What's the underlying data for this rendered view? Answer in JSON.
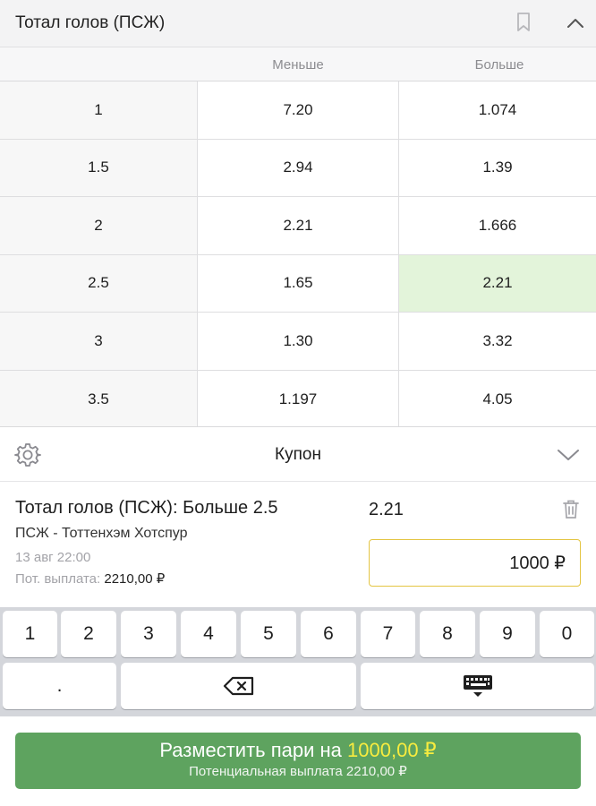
{
  "market": {
    "title": "Тотал голов (ПСЖ)",
    "icons": {
      "bookmark": "bookmark-icon",
      "collapse": "chevron-up-icon"
    }
  },
  "columns": {
    "total": "",
    "under": "Меньше",
    "over": "Больше"
  },
  "rows": [
    {
      "total": "1",
      "under": "7.20",
      "over": "1.074"
    },
    {
      "total": "1.5",
      "under": "2.94",
      "over": "1.39"
    },
    {
      "total": "2",
      "under": "2.21",
      "over": "1.666"
    },
    {
      "total": "2.5",
      "under": "1.65",
      "over": "2.21",
      "selected": "over"
    },
    {
      "total": "3",
      "under": "1.30",
      "over": "3.32"
    },
    {
      "total": "3.5",
      "under": "1.197",
      "over": "4.05"
    }
  ],
  "coupon": {
    "title": "Купон",
    "icons": {
      "settings": "gear-icon",
      "expand": "chevron-down-icon"
    }
  },
  "bet": {
    "title": "Тотал голов (ПСЖ): Больше 2.5",
    "match": "ПСЖ - Тоттенхэм Хотспур",
    "time": "13 авг 22:00",
    "payout_label": "Пот. выплата:",
    "payout_amount": "2210,00 ₽",
    "odds": "2.21",
    "stake": "1000 ₽"
  },
  "keypad": {
    "digits": [
      "1",
      "2",
      "3",
      "4",
      "5",
      "6",
      "7",
      "8",
      "9",
      "0"
    ],
    "dot": ".",
    "icons": {
      "backspace": "backspace-icon",
      "hide": "keyboard-hide-icon"
    }
  },
  "place_bet": {
    "label": "Разместить пари на",
    "amount": "1000,00 ₽",
    "sub": "Потенциальная выплата 2210,00 ₽"
  },
  "colors": {
    "selected_cell": "#e3f4da",
    "place_button": "#5ea35f",
    "amount_highlight": "#f8ec3f",
    "stake_border": "#e4c543"
  }
}
